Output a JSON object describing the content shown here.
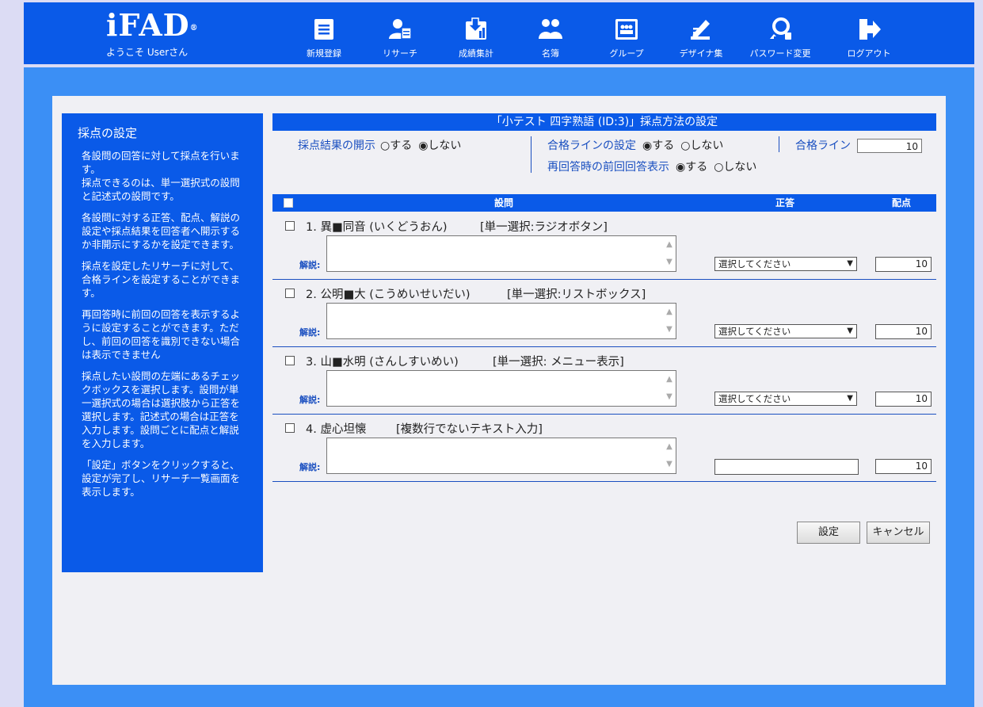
{
  "header": {
    "logo": "iFAD",
    "logo_mark": "®",
    "welcome": "ようこそ Userさん",
    "nav": [
      {
        "label": "新規登録",
        "icon": "document-icon"
      },
      {
        "label": "リサーチ",
        "icon": "research-icon"
      },
      {
        "label": "成績集計",
        "icon": "download-chart-icon"
      },
      {
        "label": "名簿",
        "icon": "people-icon"
      },
      {
        "label": "グループ",
        "icon": "group-icon"
      },
      {
        "label": "デザイナ集",
        "icon": "pen-icon"
      },
      {
        "label": "パスワード変更",
        "icon": "key-icon"
      },
      {
        "label": "ログアウト",
        "icon": "logout-icon"
      }
    ]
  },
  "help": {
    "title": "採点の設定",
    "paragraphs": [
      "各設問の回答に対して採点を行います。\n採点できるのは、単一選択式の設問と記述式の設問です。",
      "各設問に対する正答、配点、解説の設定や採点結果を回答者へ開示するか非開示にするかを設定できます。",
      "採点を設定したリサーチに対して、合格ラインを設定することができます。",
      "再回答時に前回の回答を表示するように設定することができます。ただし、前回の回答を識別できない場合は表示できません",
      "採点したい設問の左端にあるチェックボックスを選択します。設問が単一選択式の場合は選択肢から正答を選択します。記述式の場合は正答を入力します。設問ごとに配点と解説を入力します。",
      "「設定」ボタンをクリックすると、設定が完了し、リサーチ一覧画面を表示します。"
    ]
  },
  "settings": {
    "title": "「小テスト 四字熟語 (ID:3)」採点方法の設定",
    "disclose": {
      "label": "採点結果の開示",
      "yes": "○する",
      "no": "◉しない"
    },
    "passline_setting": {
      "label": "合格ラインの設定",
      "yes": "◉する",
      "no": "○しない"
    },
    "passline": {
      "label": "合格ライン",
      "value": "10"
    },
    "previous": {
      "label": "再回答時の前回回答表示",
      "yes": "◉する",
      "no": "○しない"
    }
  },
  "table": {
    "headers": {
      "question": "設問",
      "answer": "正答",
      "score": "配点"
    },
    "explanation_label": "解説:",
    "select_placeholder": "選択してください",
    "questions": [
      {
        "title": "1. 異■同音 (いくどうおん)",
        "type": "[単一選択:ラジオボタン]",
        "answer": "選択してください",
        "score": "10"
      },
      {
        "title": "2. 公明■大 (こうめいせいだい)",
        "type": "[単一選択:リストボックス]",
        "answer": "選択してください",
        "score": "10"
      },
      {
        "title": "3. 山■水明 (さんしすいめい)",
        "type": "[単一選択: メニュー表示]",
        "answer": "選択してください",
        "score": "10"
      },
      {
        "title": "4. 虚心坦懐",
        "type": "[複数行でないテキスト入力]",
        "answer": "",
        "score": "10"
      }
    ]
  },
  "buttons": {
    "submit": "設定",
    "cancel": "キャンセル"
  }
}
